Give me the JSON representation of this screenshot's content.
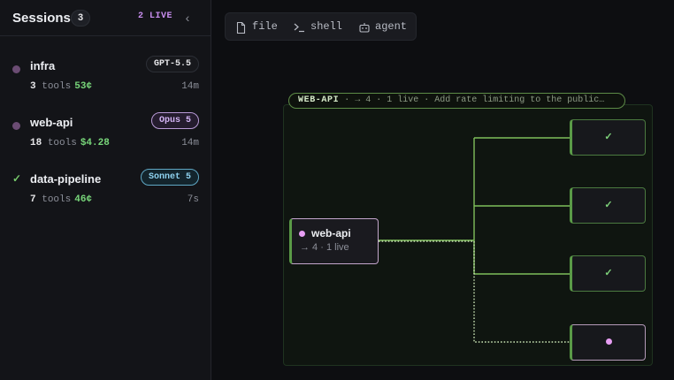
{
  "sidebar": {
    "title": "Sessions",
    "count": "3",
    "live_label": "2 LIVE",
    "collapse_icon": "chevron-left-icon",
    "collapse_glyph": "‹",
    "sessions": [
      {
        "name": "infra",
        "status": "live",
        "model": "GPT-5.5",
        "tools_count": "3",
        "tools_label": "tools",
        "cost": "53¢",
        "time": "14m"
      },
      {
        "name": "web-api",
        "status": "live",
        "model": "Opus 5",
        "tools_count": "18",
        "tools_label": "tools",
        "cost": "$4.28",
        "time": "14m"
      },
      {
        "name": "data-pipeline",
        "status": "done",
        "status_glyph": "✓",
        "model": "Sonnet 5",
        "tools_count": "7",
        "tools_label": "tools",
        "cost": "46¢",
        "time": "7s"
      }
    ]
  },
  "toolbar": {
    "file_label": "file",
    "shell_label": "shell",
    "agent_label": "agent"
  },
  "graph": {
    "pill": {
      "name": "WEB-API",
      "details": "· → 4 · 1 live · Add rate limiting to the public…"
    },
    "root": {
      "name": "web-api",
      "subtitle": "→ 4 · 1 live"
    },
    "children": [
      {
        "status": "done",
        "glyph": "✓"
      },
      {
        "status": "done",
        "glyph": "✓"
      },
      {
        "status": "done",
        "glyph": "✓"
      },
      {
        "status": "live"
      }
    ]
  },
  "colors": {
    "accent_live": "#e79ef3",
    "accent_done": "#78d67a",
    "link": "#7fbf5a",
    "gpt_badge": "#e6e6e9",
    "opus_badge": "#d3b4f5",
    "sonnet_badge": "#8fd3f0"
  }
}
